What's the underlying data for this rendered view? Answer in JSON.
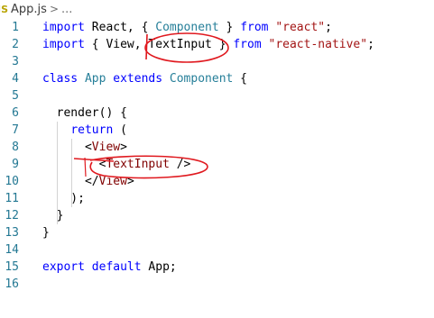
{
  "breadcrumb": {
    "icon_text": "JS",
    "file": "App.js",
    "separator": ">",
    "extra": "..."
  },
  "editor": {
    "lines": [
      {
        "n": "1",
        "tokens": [
          [
            "kw",
            "import"
          ],
          [
            "plain",
            " React, { "
          ],
          [
            "ident",
            "Component"
          ],
          [
            "plain",
            " } "
          ],
          [
            "kw",
            "from"
          ],
          [
            "plain",
            " "
          ],
          [
            "str",
            "\"react\""
          ],
          [
            "plain",
            ";"
          ]
        ]
      },
      {
        "n": "2",
        "tokens": [
          [
            "kw",
            "import"
          ],
          [
            "plain",
            " { View, "
          ],
          [
            "plain",
            "TextInput"
          ],
          [
            "plain",
            " } "
          ],
          [
            "kw",
            "from"
          ],
          [
            "plain",
            " "
          ],
          [
            "str",
            "\"react-native\""
          ],
          [
            "plain",
            ";"
          ]
        ]
      },
      {
        "n": "3",
        "tokens": []
      },
      {
        "n": "4",
        "tokens": [
          [
            "kw",
            "class"
          ],
          [
            "plain",
            " "
          ],
          [
            "ident",
            "App"
          ],
          [
            "plain",
            " "
          ],
          [
            "kw",
            "extends"
          ],
          [
            "plain",
            " "
          ],
          [
            "ident",
            "Component"
          ],
          [
            "plain",
            " {"
          ]
        ]
      },
      {
        "n": "5",
        "tokens": []
      },
      {
        "n": "6",
        "tokens": [
          [
            "plain",
            "  render() {"
          ]
        ]
      },
      {
        "n": "7",
        "tokens": [
          [
            "plain",
            "    "
          ],
          [
            "kw",
            "return"
          ],
          [
            "plain",
            " ("
          ]
        ]
      },
      {
        "n": "8",
        "tokens": [
          [
            "plain",
            "      <"
          ],
          [
            "tag",
            "View"
          ],
          [
            "plain",
            ">"
          ]
        ]
      },
      {
        "n": "9",
        "tokens": [
          [
            "plain",
            "        <"
          ],
          [
            "tag",
            "TextInput"
          ],
          [
            "plain",
            " />"
          ]
        ]
      },
      {
        "n": "10",
        "tokens": [
          [
            "plain",
            "      </"
          ],
          [
            "tag",
            "View"
          ],
          [
            "plain",
            ">"
          ]
        ]
      },
      {
        "n": "11",
        "tokens": [
          [
            "plain",
            "    );"
          ]
        ]
      },
      {
        "n": "12",
        "tokens": [
          [
            "plain",
            "  }"
          ]
        ]
      },
      {
        "n": "13",
        "tokens": [
          [
            "plain",
            "}"
          ]
        ]
      },
      {
        "n": "14",
        "tokens": []
      },
      {
        "n": "15",
        "tokens": [
          [
            "kw",
            "export"
          ],
          [
            "plain",
            " "
          ],
          [
            "kw",
            "default"
          ],
          [
            "plain",
            " App;"
          ]
        ]
      },
      {
        "n": "16",
        "tokens": []
      }
    ]
  },
  "annotation_color": "#e0191f"
}
